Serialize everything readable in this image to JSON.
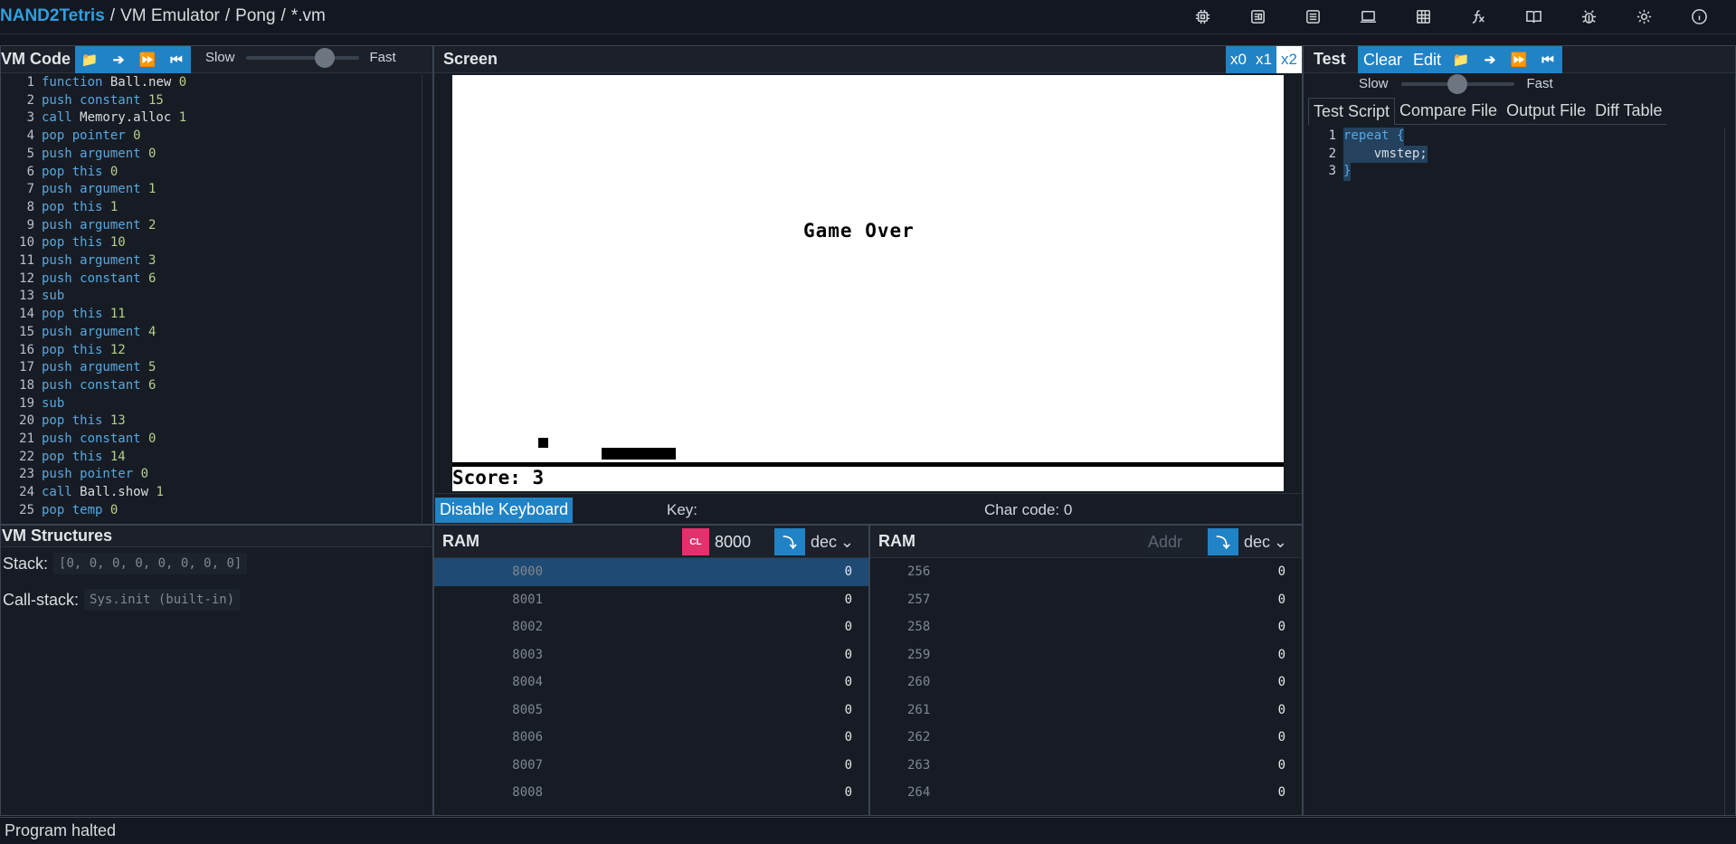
{
  "breadcrumb": {
    "brand": "NAND2Tetris",
    "items": [
      "VM Emulator",
      "Pong",
      "*.vm"
    ]
  },
  "top_icons": [
    "chip-icon",
    "cpu-icon",
    "assembler-icon",
    "vm-screen-icon",
    "compiler-grid-icon",
    "bitmap-editor-fx-icon",
    "book-icon",
    "bug-icon",
    "gear-icon",
    "info-icon"
  ],
  "vm_code": {
    "title": "VM Code",
    "speed_slow": "Slow",
    "speed_fast": "Fast",
    "speed_level": 0.7,
    "lines": [
      [
        "function",
        "Ball.new",
        "0"
      ],
      [
        "push constant",
        "",
        "15"
      ],
      [
        "call",
        "Memory.alloc",
        "1"
      ],
      [
        "pop pointer",
        "",
        "0"
      ],
      [
        "push argument",
        "",
        "0"
      ],
      [
        "pop this",
        "",
        "0"
      ],
      [
        "push argument",
        "",
        "1"
      ],
      [
        "pop this",
        "",
        "1"
      ],
      [
        "push argument",
        "",
        "2"
      ],
      [
        "pop this",
        "",
        "10"
      ],
      [
        "push argument",
        "",
        "3"
      ],
      [
        "push constant",
        "",
        "6"
      ],
      [
        "sub",
        "",
        ""
      ],
      [
        "pop this",
        "",
        "11"
      ],
      [
        "push argument",
        "",
        "4"
      ],
      [
        "pop this",
        "",
        "12"
      ],
      [
        "push argument",
        "",
        "5"
      ],
      [
        "push constant",
        "",
        "6"
      ],
      [
        "sub",
        "",
        ""
      ],
      [
        "pop this",
        "",
        "13"
      ],
      [
        "push constant",
        "",
        "0"
      ],
      [
        "pop this",
        "",
        "14"
      ],
      [
        "push pointer",
        "",
        "0"
      ],
      [
        "call",
        "Ball.show",
        "1"
      ],
      [
        "pop temp",
        "",
        "0"
      ]
    ]
  },
  "vm_structures": {
    "title": "VM Structures",
    "stack_label": "Stack:",
    "stack_value": "[0, 0, 0, 0, 0, 0, 0, 0]",
    "callstack_label": "Call-stack:",
    "callstack_value": "Sys.init (built-in)"
  },
  "screen": {
    "title": "Screen",
    "zoom_options": [
      "x0",
      "x1",
      "x2"
    ],
    "zoom_selected": "x2",
    "game_over_text": "Game Over",
    "score_text": "Score: 3",
    "keyboard_button": "Disable Keyboard",
    "key_label": "Key:",
    "char_code_label": "Char code: 0"
  },
  "ram_left": {
    "title": "RAM",
    "clear_badge": "CL",
    "address_value": "8000",
    "format": "dec",
    "rows": [
      {
        "addr": "8000",
        "val": "0"
      },
      {
        "addr": "8001",
        "val": "0"
      },
      {
        "addr": "8002",
        "val": "0"
      },
      {
        "addr": "8003",
        "val": "0"
      },
      {
        "addr": "8004",
        "val": "0"
      },
      {
        "addr": "8005",
        "val": "0"
      },
      {
        "addr": "8006",
        "val": "0"
      },
      {
        "addr": "8007",
        "val": "0"
      },
      {
        "addr": "8008",
        "val": "0"
      }
    ]
  },
  "ram_right": {
    "title": "RAM",
    "address_placeholder": "Addr",
    "format": "dec",
    "rows": [
      {
        "addr": "256",
        "val": "0"
      },
      {
        "addr": "257",
        "val": "0"
      },
      {
        "addr": "258",
        "val": "0"
      },
      {
        "addr": "259",
        "val": "0"
      },
      {
        "addr": "260",
        "val": "0"
      },
      {
        "addr": "261",
        "val": "0"
      },
      {
        "addr": "262",
        "val": "0"
      },
      {
        "addr": "263",
        "val": "0"
      },
      {
        "addr": "264",
        "val": "0"
      }
    ]
  },
  "test": {
    "title": "Test",
    "clear_label": "Clear",
    "edit_label": "Edit",
    "speed_slow": "Slow",
    "speed_fast": "Fast",
    "speed_level": 0.5,
    "tabs": [
      "Test Script",
      "Compare File",
      "Output File",
      "Diff Table"
    ],
    "active_tab": "Test Script",
    "script_lines": [
      "repeat {",
      "    vmstep;",
      "}"
    ]
  },
  "status": "Program halted",
  "colors": {
    "accent": "#2083c6",
    "brand": "#2f9fe0",
    "clear_badge": "#e2316c",
    "background": "#171c24"
  }
}
